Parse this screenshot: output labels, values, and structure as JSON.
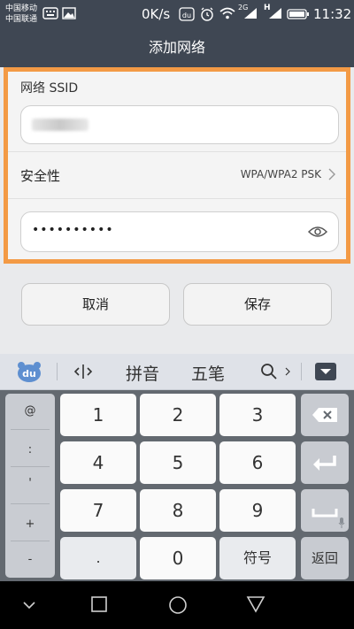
{
  "status_bar": {
    "carrier_1": "中国移动",
    "carrier_2": "中国联通",
    "speed": "0K/s",
    "network_2g": "2G",
    "network_h": "H",
    "time": "11:32"
  },
  "title_bar": {
    "title": "添加网络"
  },
  "form": {
    "ssid_label": "网络 SSID",
    "security_label": "安全性",
    "security_value": "WPA/WPA2 PSK",
    "password_value": "••••••••••"
  },
  "buttons": {
    "cancel": "取消",
    "save": "保存"
  },
  "keyboard_toolbar": {
    "pinyin": "拼音",
    "wubi": "五笔",
    "logo": "du"
  },
  "keyboard": {
    "symbols": [
      "@",
      ":",
      "'",
      "+",
      "-"
    ],
    "digits": [
      "1",
      "2",
      "3",
      "4",
      "5",
      "6",
      "7",
      "8",
      "9"
    ],
    "dot": ".",
    "zero": "0",
    "symbol_key": "符号",
    "back_key": "返回"
  },
  "colors": {
    "accent": "#f39a45",
    "header": "#3f4753"
  }
}
